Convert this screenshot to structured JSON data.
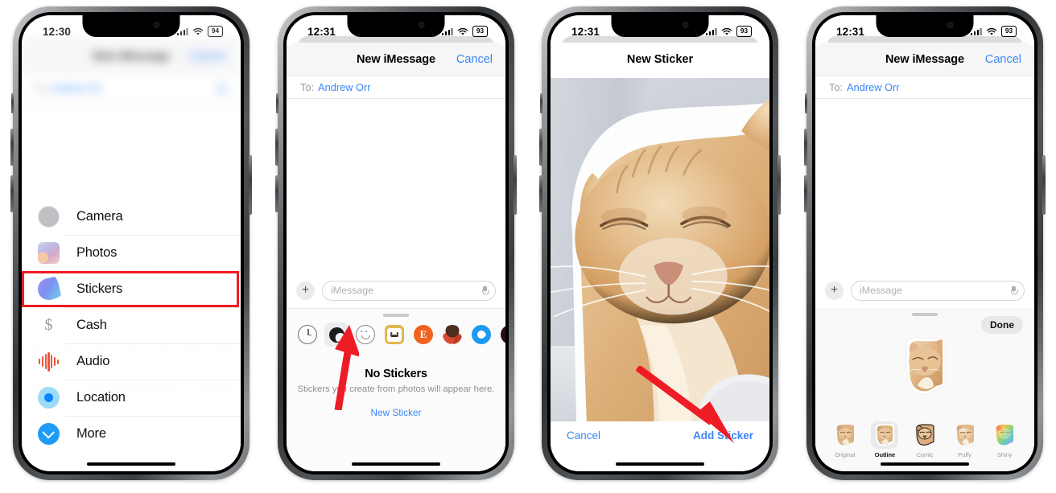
{
  "colors": {
    "accent_blue": "#3a86f7",
    "annotation_red": "#ee1c25",
    "sticker_app_gradient": "#7e8ff2",
    "audio_red": "#f0573c",
    "location_blue": "#0b84ff",
    "more_blue": "#1e9bf5"
  },
  "phones": [
    {
      "status": {
        "time": "12:30",
        "battery": "94"
      },
      "background": {
        "nav_title": "New iMessage",
        "cancel_label": "Cancel",
        "to_label": "To:",
        "to_value": "Andrew Orr"
      },
      "app_list": [
        {
          "label": "Camera",
          "icon": "camera-icon"
        },
        {
          "label": "Photos",
          "icon": "photos-icon"
        },
        {
          "label": "Stickers",
          "icon": "stickers-icon",
          "highlighted": true
        },
        {
          "label": "Cash",
          "icon": "cash-icon"
        },
        {
          "label": "Audio",
          "icon": "audio-icon"
        },
        {
          "label": "Location",
          "icon": "location-icon"
        },
        {
          "label": "More",
          "icon": "more-chevron-icon"
        }
      ]
    },
    {
      "status": {
        "time": "12:31",
        "battery": "93"
      },
      "nav": {
        "title": "New iMessage",
        "cancel_label": "Cancel"
      },
      "to": {
        "label": "To:",
        "value": "Andrew Orr"
      },
      "composer": {
        "placeholder": "iMessage"
      },
      "app_strip": [
        {
          "name": "recents-icon",
          "selected": false
        },
        {
          "name": "stickers-icon",
          "selected": true
        },
        {
          "name": "emoji-icon",
          "selected": false
        },
        {
          "name": "bear-app-icon",
          "selected": false
        },
        {
          "name": "etsy-app-icon",
          "label": "E",
          "selected": false
        },
        {
          "name": "face-app-icon",
          "selected": false
        },
        {
          "name": "drop-app-icon",
          "selected": false
        },
        {
          "name": "dark-app-icon",
          "selected": false
        }
      ],
      "empty_state": {
        "title": "No Stickers",
        "subtitle": "Stickers you create from photos will appear here.",
        "link": "New Sticker"
      }
    },
    {
      "status": {
        "time": "12:31",
        "battery": "93"
      },
      "nav": {
        "title": "New Sticker"
      },
      "photo": {
        "subject": "sleeping orange tabby cat"
      },
      "actions": {
        "cancel_label": "Cancel",
        "confirm_label": "Add Sticker"
      }
    },
    {
      "status": {
        "time": "12:31",
        "battery": "93"
      },
      "nav": {
        "title": "New iMessage",
        "cancel_label": "Cancel"
      },
      "to": {
        "label": "To:",
        "value": "Andrew Orr"
      },
      "composer": {
        "placeholder": "iMessage"
      },
      "done_label": "Done",
      "effects": [
        {
          "label": "Original",
          "selected": false
        },
        {
          "label": "Outline",
          "selected": true
        },
        {
          "label": "Comic",
          "selected": false
        },
        {
          "label": "Puffy",
          "selected": false
        },
        {
          "label": "Shiny",
          "selected": false
        }
      ]
    }
  ]
}
